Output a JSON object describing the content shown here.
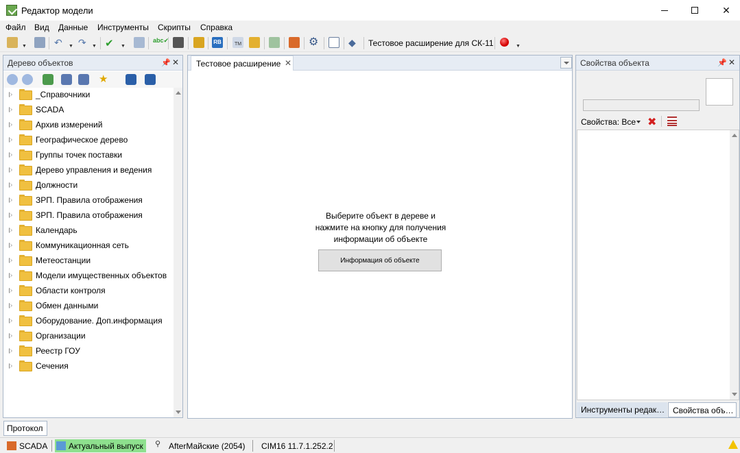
{
  "window": {
    "title": "Редактор модели",
    "app_icon": "model-editor-icon"
  },
  "menu": [
    "Файл",
    "Вид",
    "Данные",
    "Инструменты",
    "Скрипты",
    "Справка"
  ],
  "toolbar": {
    "extension_label": "Тестовое расширение для СК-11",
    "icons": [
      "new-icon",
      "save-icon",
      "undo-icon",
      "redo-icon",
      "check-icon",
      "edit-icon",
      "spellcheck-icon",
      "find-icon",
      "brush-icon",
      "rb-icon",
      "tm-icon",
      "tm-folder-icon",
      "list-check-icon",
      "grid-icon",
      "gear-icon",
      "layout-icon",
      "diamond-icon",
      "record-icon"
    ]
  },
  "object_tree": {
    "title": "Дерево объектов",
    "items": [
      "_Справочники",
      "SCADA",
      "Архив измерений",
      "Географическое дерево",
      "Группы точек поставки",
      "Дерево управления и ведения",
      "Должности",
      "ЗРП. Правила отображения",
      "ЗРП. Правила отображения",
      "Календарь",
      "Коммуникационная сеть",
      "Метеостанции",
      "Модели имущественных объектов",
      "Области контроля",
      "Обмен данными",
      "Оборудование. Доп.информация",
      "Организации",
      "Реестр ГОУ",
      "Сечения"
    ]
  },
  "document": {
    "tab_label": "Тестовое расширение",
    "message_lines": [
      "Выберите объект в дереве и",
      "нажмите на кнопку для получения",
      "информации об объекте"
    ],
    "button_label": "Информация об объекте"
  },
  "properties_panel": {
    "title": "Свойства объекта",
    "filter_label": "Свойства: Все",
    "tabs": [
      "Инструменты редак…",
      "Свойства объ…"
    ]
  },
  "bottom": {
    "protocol_tab": "Протокол"
  },
  "statusbar": {
    "scada": "SCADA",
    "release": "Актуальный выпуск",
    "branch": "AfterМайские (2054)",
    "version": "CIM16 11.7.1.252.2",
    "release_color": "#8ee08e"
  }
}
